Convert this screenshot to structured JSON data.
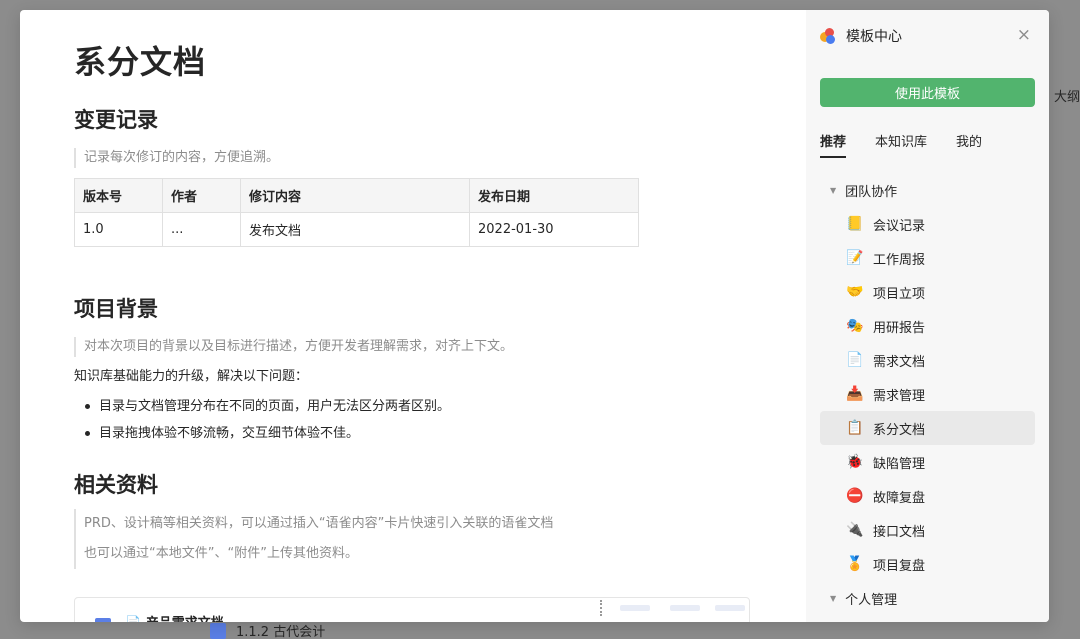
{
  "background": {
    "right_text": "大纲",
    "bottom_doc": "1.1.2 古代会计"
  },
  "doc": {
    "title": "系分文档",
    "sec1": {
      "heading": "变更记录",
      "quote": "记录每次修订的内容，方便追溯。",
      "table": {
        "headers": [
          "版本号",
          "作者",
          "修订内容",
          "发布日期"
        ],
        "rows": [
          [
            "1.0",
            "...",
            "发布文档",
            "2022-01-30"
          ]
        ]
      }
    },
    "sec2": {
      "heading": "项目背景",
      "quote": "对本次项目的背景以及目标进行描述，方便开发者理解需求，对齐上下文。",
      "para": "知识库基础能力的升级，解决以下问题：",
      "bullets": [
        "目录与文档管理分布在不同的页面，用户无法区分两者区别。",
        "目录拖拽体验不够流畅，交互细节体验不佳。"
      ]
    },
    "sec3": {
      "heading": "相关资料",
      "quote1": "PRD、设计稿等相关资料，可以通过插入“语雀内容”卡片快速引入关联的语雀文档",
      "quote2": "也可以通过“本地文件”、“附件”上传其他资料。",
      "card_title": "📄 产品需求文档"
    }
  },
  "sidebar": {
    "title": "模板中心",
    "close_icon": "×",
    "use_button": "使用此模板",
    "tabs": [
      "推荐",
      "本知识库",
      "我的"
    ],
    "group1": "团队协作",
    "items": [
      {
        "icon": "📒",
        "label": "会议记录"
      },
      {
        "icon": "📝",
        "label": "工作周报"
      },
      {
        "icon": "🤝",
        "label": "项目立项"
      },
      {
        "icon": "🎭",
        "label": "用研报告"
      },
      {
        "icon": "📄",
        "label": "需求文档"
      },
      {
        "icon": "📥",
        "label": "需求管理"
      },
      {
        "icon": "📋",
        "label": "系分文档"
      },
      {
        "icon": "🐞",
        "label": "缺陷管理"
      },
      {
        "icon": "⛔",
        "label": "故障复盘"
      },
      {
        "icon": "🔌",
        "label": "接口文档"
      },
      {
        "icon": "🏅",
        "label": "项目复盘"
      }
    ],
    "group2": "个人管理",
    "selected_index": 6
  },
  "colors": {
    "accent_green": "#52b46e",
    "selected_bg": "#e9e9e9"
  }
}
